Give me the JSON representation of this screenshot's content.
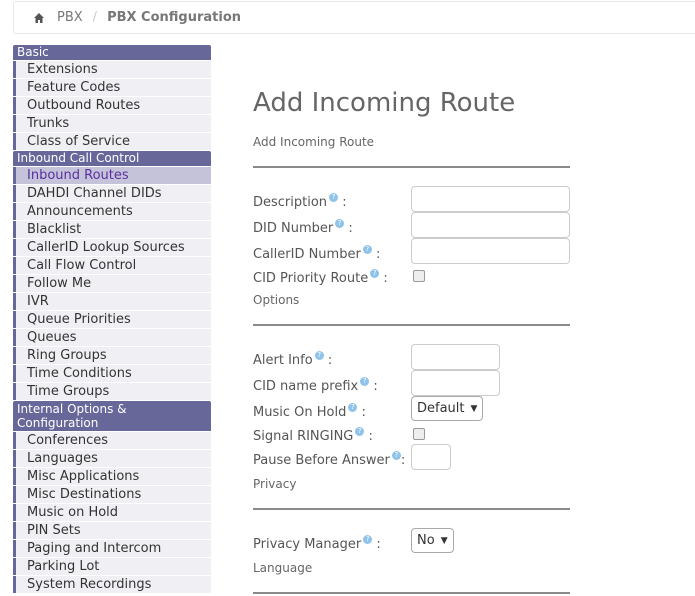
{
  "breadcrumb": {
    "home_icon": "home-icon",
    "items": [
      "PBX",
      "PBX Configuration"
    ],
    "separator": "/"
  },
  "sidebar": {
    "sections": [
      {
        "header": "Basic",
        "items": [
          "Extensions",
          "Feature Codes",
          "Outbound Routes",
          "Trunks",
          "Class of Service"
        ]
      },
      {
        "header": "Inbound Call Control",
        "items": [
          "Inbound Routes",
          "DAHDI Channel DIDs",
          "Announcements",
          "Blacklist",
          "CallerID Lookup Sources",
          "Call Flow Control",
          "Follow Me",
          "IVR",
          "Queue Priorities",
          "Queues",
          "Ring Groups",
          "Time Conditions",
          "Time Groups"
        ],
        "active": "Inbound Routes"
      },
      {
        "header": "Internal Options & Configuration",
        "items": [
          "Conferences",
          "Languages",
          "Misc Applications",
          "Misc Destinations",
          "Music on Hold",
          "PIN Sets",
          "Paging and Intercom",
          "Parking Lot",
          "System Recordings"
        ]
      }
    ]
  },
  "main": {
    "title": "Add Incoming Route",
    "subtitle": "Add Incoming Route",
    "help_icon": "help-icon",
    "colon": ":",
    "fields": {
      "description": {
        "label": "Description",
        "value": ""
      },
      "did_number": {
        "label": "DID Number",
        "value": ""
      },
      "callerid_number": {
        "label": "CallerID Number",
        "value": ""
      },
      "cid_priority_route": {
        "label": "CID Priority Route",
        "checked": false
      },
      "alert_info": {
        "label": "Alert Info",
        "value": ""
      },
      "cid_name_prefix": {
        "label": "CID name prefix",
        "value": ""
      },
      "music_on_hold": {
        "label": "Music On Hold",
        "selected": "Default"
      },
      "signal_ringing": {
        "label": "Signal RINGING",
        "checked": false
      },
      "pause_before_answer": {
        "label": "Pause Before Answer",
        "value": ""
      },
      "privacy_manager": {
        "label": "Privacy Manager",
        "selected": "No"
      }
    },
    "sections": {
      "options": "Options",
      "privacy": "Privacy",
      "language": "Language"
    },
    "select_arrow": "▼"
  },
  "colors": {
    "sidebar_header": "#67679a",
    "sidebar_item_bg": "#f0eff3",
    "sidebar_active_bg": "#c4c3da",
    "sidebar_active_text": "#5a2f9e",
    "help_icon": "#8fc3ea"
  }
}
